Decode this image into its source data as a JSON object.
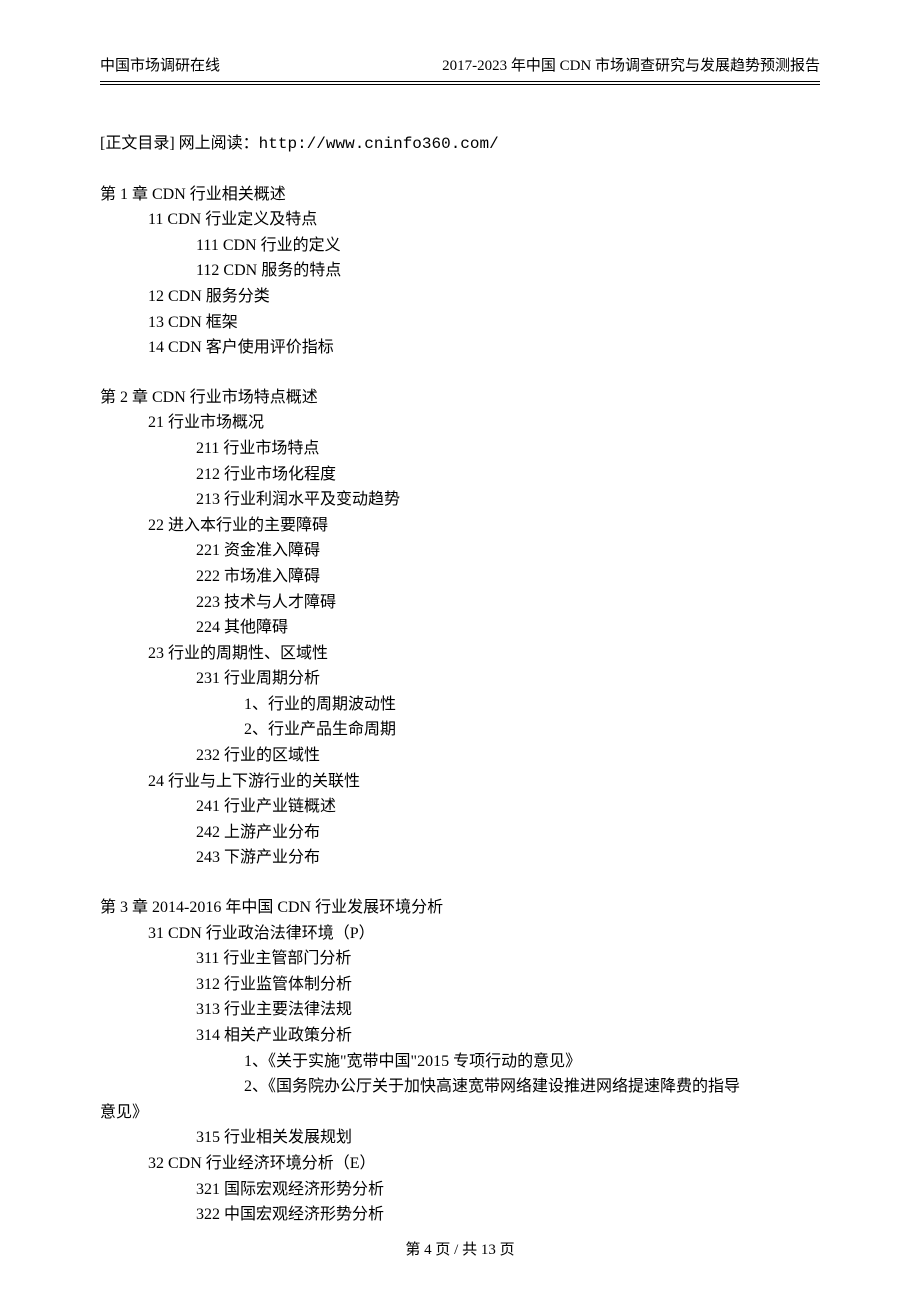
{
  "header": {
    "left": "中国市场调研在线",
    "right": "2017-2023 年中国 CDN 市场调查研究与发展趋势预测报告"
  },
  "intro": {
    "label": "[正文目录] 网上阅读：",
    "url": "http://www.cninfo360.com/"
  },
  "toc": [
    {
      "title": "第 1 章   CDN 行业相关概述",
      "lines": [
        {
          "lvl": 1,
          "t": "11 CDN 行业定义及特点"
        },
        {
          "lvl": 2,
          "t": "111 CDN 行业的定义"
        },
        {
          "lvl": 2,
          "t": "112 CDN 服务的特点"
        },
        {
          "lvl": 1,
          "t": "12 CDN 服务分类"
        },
        {
          "lvl": 1,
          "t": "13 CDN 框架"
        },
        {
          "lvl": 1,
          "t": "14 CDN 客户使用评价指标"
        }
      ]
    },
    {
      "title": "第 2 章    CDN 行业市场特点概述",
      "lines": [
        {
          "lvl": 1,
          "t": "21 行业市场概况"
        },
        {
          "lvl": 2,
          "t": "211 行业市场特点"
        },
        {
          "lvl": 2,
          "t": "212 行业市场化程度"
        },
        {
          "lvl": 2,
          "t": "213 行业利润水平及变动趋势"
        },
        {
          "lvl": 1,
          "t": "22 进入本行业的主要障碍"
        },
        {
          "lvl": 2,
          "t": "221 资金准入障碍"
        },
        {
          "lvl": 2,
          "t": "222 市场准入障碍"
        },
        {
          "lvl": 2,
          "t": "223 技术与人才障碍"
        },
        {
          "lvl": 2,
          "t": "224 其他障碍"
        },
        {
          "lvl": 1,
          "t": "23 行业的周期性、区域性"
        },
        {
          "lvl": 2,
          "t": "231 行业周期分析"
        },
        {
          "lvl": 3,
          "t": "1、行业的周期波动性"
        },
        {
          "lvl": 3,
          "t": "2、行业产品生命周期"
        },
        {
          "lvl": 2,
          "t": "232 行业的区域性"
        },
        {
          "lvl": 1,
          "t": "24 行业与上下游行业的关联性"
        },
        {
          "lvl": 2,
          "t": "241 行业产业链概述"
        },
        {
          "lvl": 2,
          "t": "242 上游产业分布"
        },
        {
          "lvl": 2,
          "t": "243 下游产业分布"
        }
      ]
    },
    {
      "title": "第 3 章    2014-2016 年中国 CDN 行业发展环境分析",
      "lines": [
        {
          "lvl": 1,
          "t": "31 CDN 行业政治法律环境（P）"
        },
        {
          "lvl": 2,
          "t": "311 行业主管部门分析"
        },
        {
          "lvl": 2,
          "t": "312 行业监管体制分析"
        },
        {
          "lvl": 2,
          "t": "313 行业主要法律法规"
        },
        {
          "lvl": 2,
          "t": "314 相关产业政策分析"
        },
        {
          "lvl": 3,
          "t": "1、《关于实施\"宽带中国\"2015 专项行动的意见》"
        },
        {
          "lvl": 3,
          "t": "2、《国务院办公厅关于加快高速宽带网络建设推进网络提速降费的指导"
        },
        {
          "lvl": -1,
          "t": "意见》"
        },
        {
          "lvl": 2,
          "t": "315 行业相关发展规划"
        },
        {
          "lvl": 1,
          "t": "32 CDN 行业经济环境分析（E）"
        },
        {
          "lvl": 2,
          "t": "321 国际宏观经济形势分析"
        },
        {
          "lvl": 2,
          "t": "322 中国宏观经济形势分析"
        }
      ]
    }
  ],
  "footer": {
    "prefix": "第 ",
    "current": "4",
    "mid": " 页 / 共 ",
    "total": "13",
    "suffix": " 页"
  }
}
